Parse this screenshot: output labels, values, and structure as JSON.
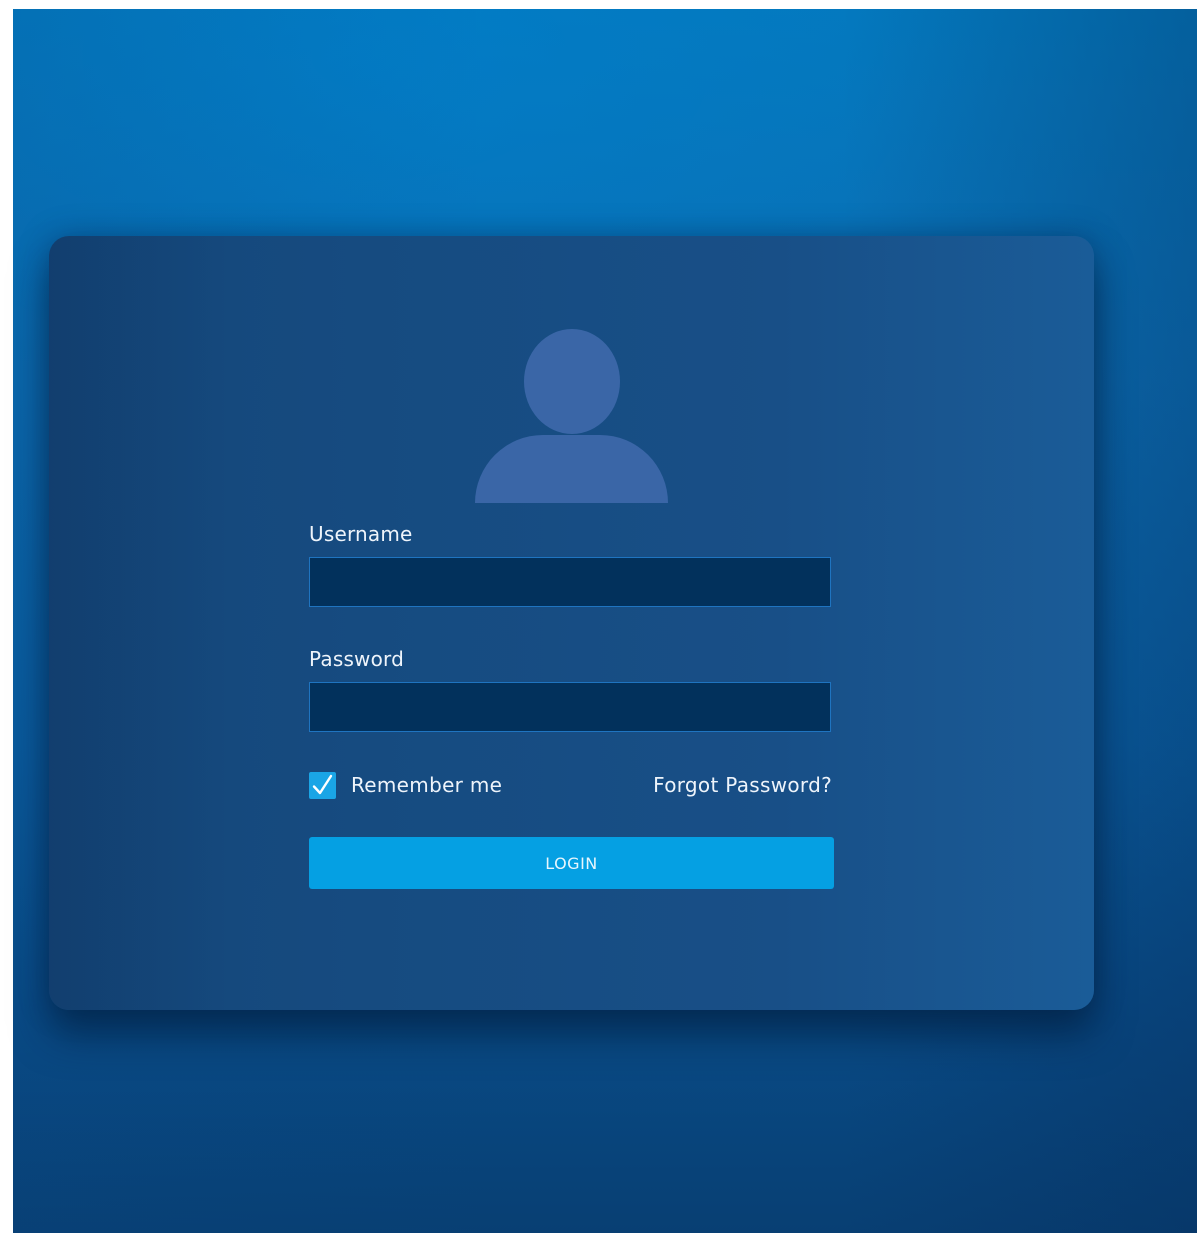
{
  "login": {
    "username_label": "Username",
    "username_value": "",
    "password_label": "Password",
    "password_value": "",
    "remember_label": "Remember me",
    "remember_checked": true,
    "forgot_label": "Forgot Password?",
    "login_label": "LOGIN"
  },
  "icons": {
    "avatar": "user-avatar-icon",
    "checkmark": "checkmark-icon"
  },
  "colors": {
    "accent": "#05a0e3",
    "card": "#164b80",
    "input_bg": "#02315c",
    "avatar": "#3a66a7",
    "background": "#0a6db2"
  }
}
